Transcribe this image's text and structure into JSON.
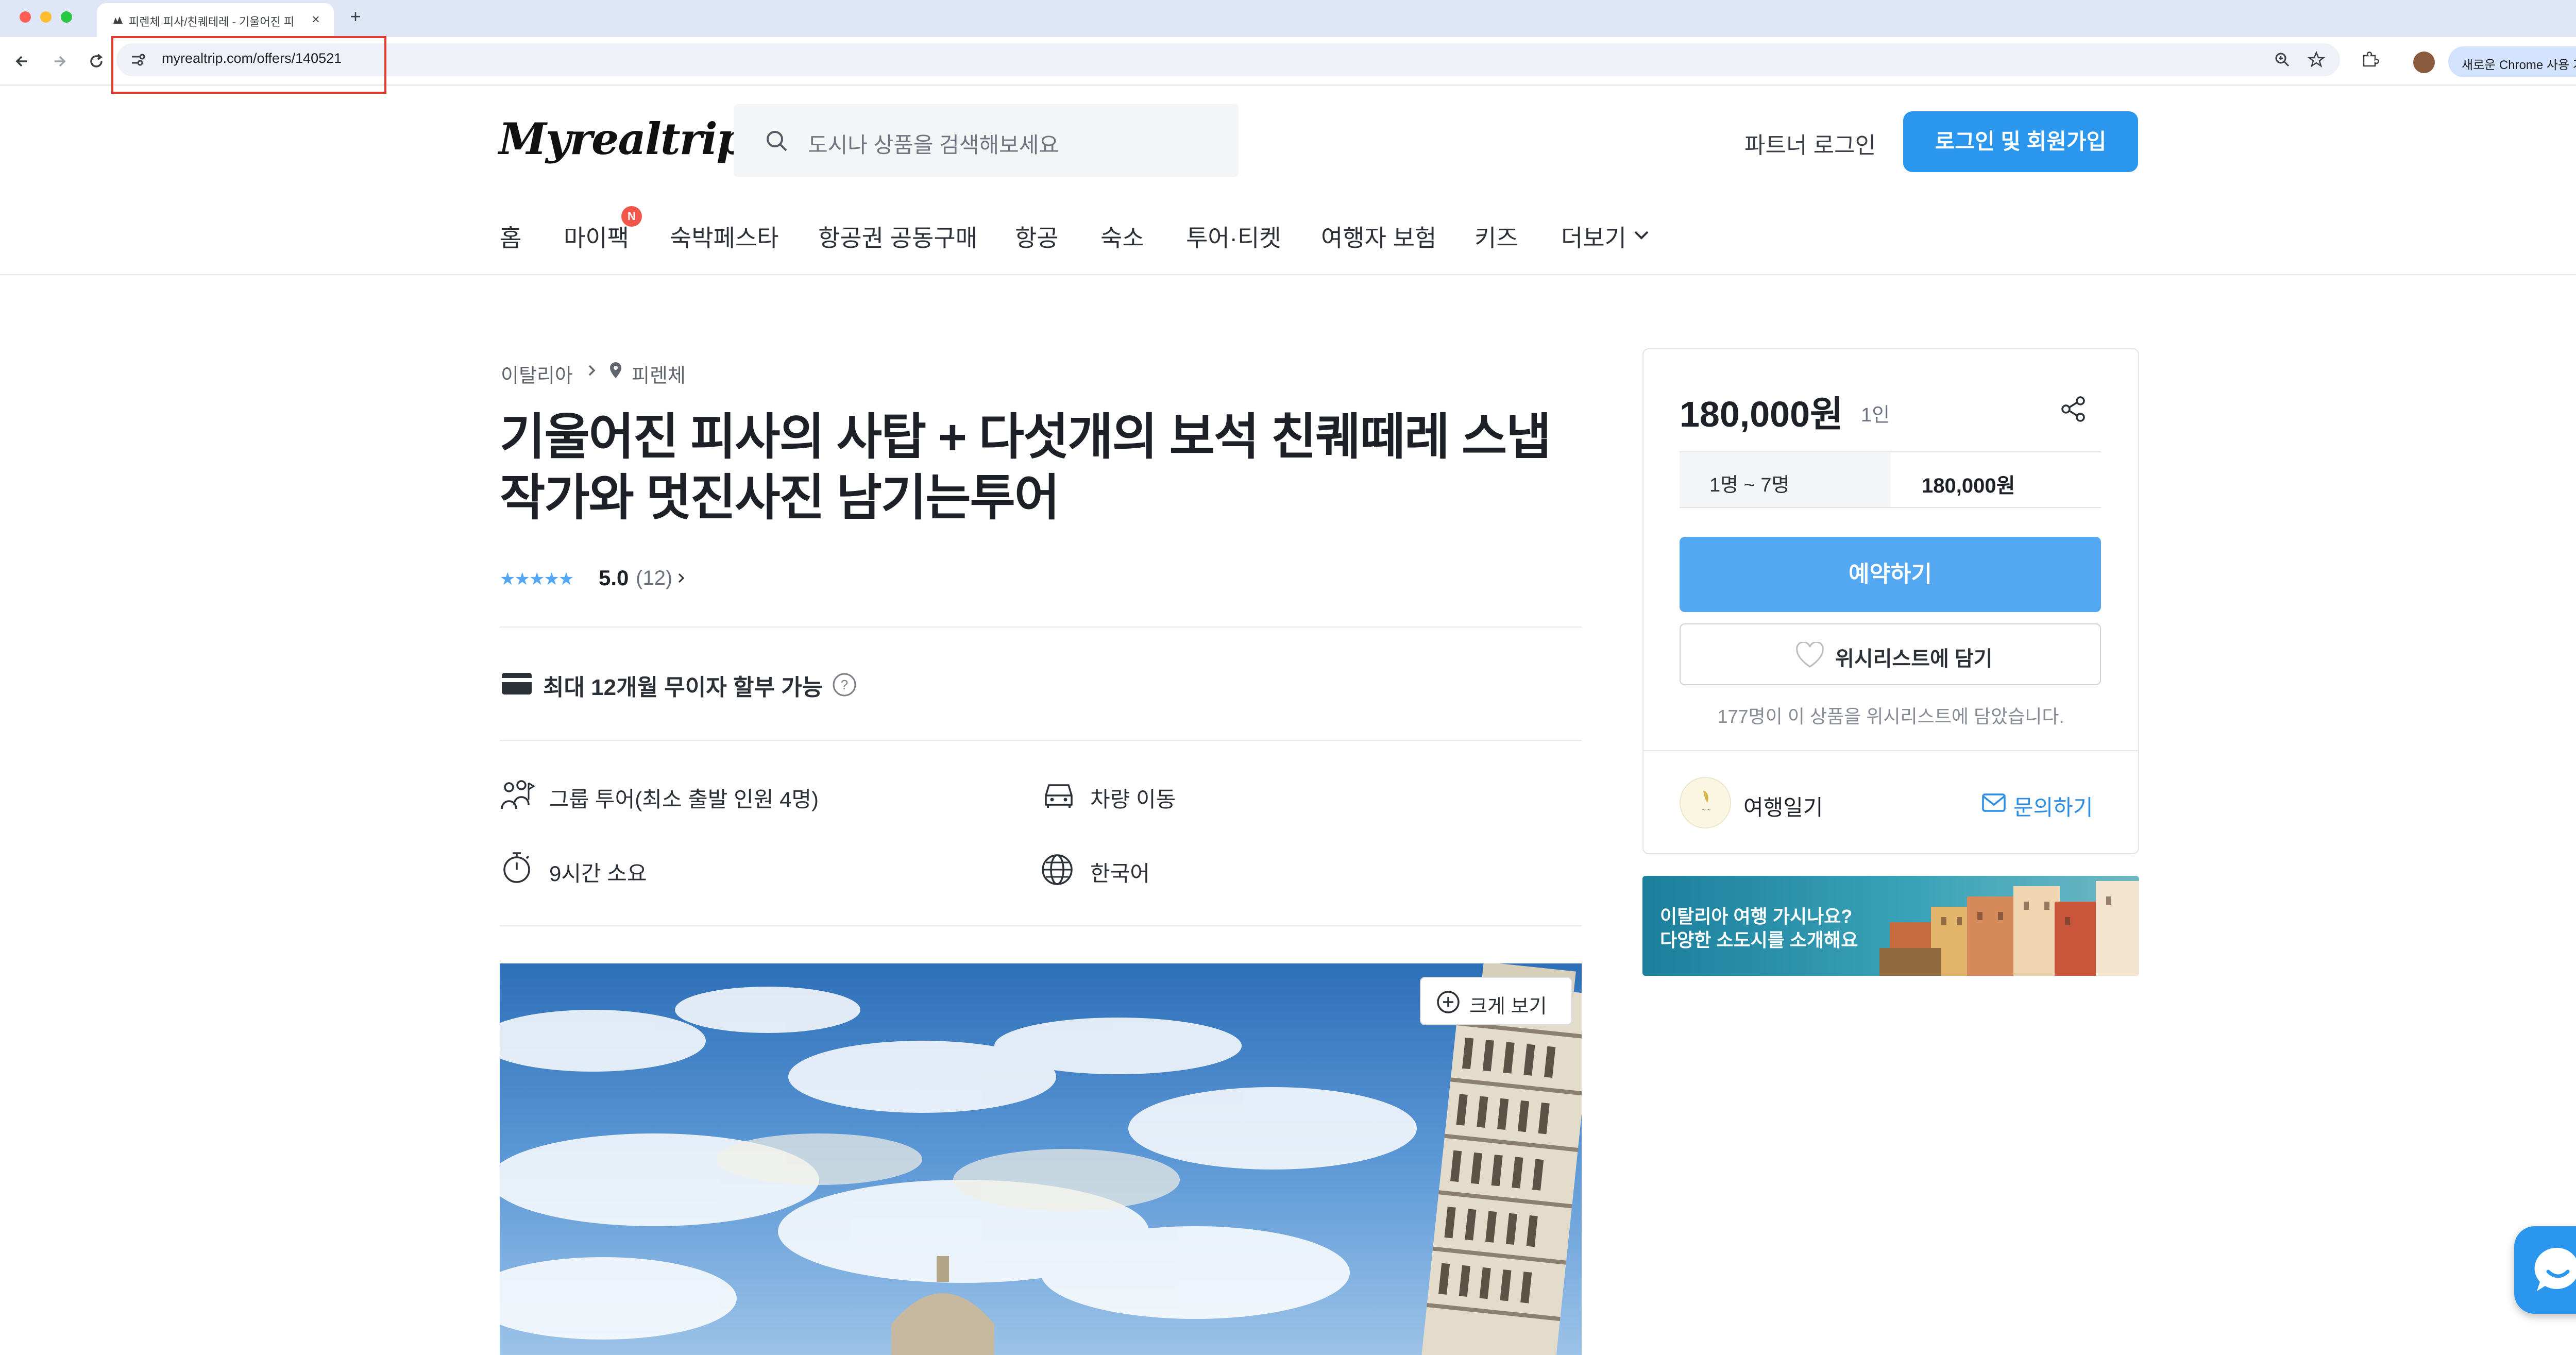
{
  "browser": {
    "tab_title": "피렌체 피사/친퀘테레 - 기울어진 피",
    "url": "myrealtrip.com/offers/140521",
    "profile_pill": "새로운 Chrome 사용 가능"
  },
  "site": {
    "logo": "Myrealtrip",
    "search_placeholder": "도시나 상품을 검색해보세요",
    "partner_login": "파트너 로그인",
    "login_signup": "로그인 및 회원가입",
    "nav": [
      {
        "label": "홈"
      },
      {
        "label": "마이팩",
        "badge": "N"
      },
      {
        "label": "숙박페스타"
      },
      {
        "label": "항공권 공동구매"
      },
      {
        "label": "항공"
      },
      {
        "label": "숙소"
      },
      {
        "label": "투어·티켓"
      },
      {
        "label": "여행자 보험"
      },
      {
        "label": "키즈"
      },
      {
        "label": "더보기"
      }
    ]
  },
  "product": {
    "breadcrumb_country": "이탈리아",
    "breadcrumb_city": "피렌체",
    "title": "기울어진 피사의 사탑 + 다섯개의 보석 친퀘떼레 스냅작가와 멋진사진 남기는투어",
    "rating_score": "5.0",
    "rating_count": "(12)",
    "rating_stars": 5,
    "installment": "최대 12개월 무이자 할부 가능",
    "features": [
      {
        "icon": "group-tour-icon",
        "label": "그룹 투어(최소 출발 인원 4명)"
      },
      {
        "icon": "car-icon",
        "label": "차량 이동"
      },
      {
        "icon": "timer-icon",
        "label": "9시간 소요"
      },
      {
        "icon": "globe-icon",
        "label": "한국어"
      }
    ],
    "zoom_label": "크게 보기"
  },
  "booking": {
    "price": "180,000원",
    "per_person": "1인",
    "option_people": "1명 ~ 7명",
    "option_price": "180,000원",
    "book_label": "예약하기",
    "wishlist_label": "위시리스트에 담기",
    "wishlist_count_text": "177명이 이 상품을 위시리스트에 담았습니다.",
    "host_name": "여행일기",
    "contact_label": "문의하기"
  },
  "banner": {
    "line1": "이탈리아 여행 가시나요?",
    "line2": "다양한 소도시를 소개해요"
  },
  "colors": {
    "brand_blue": "#2b96ed",
    "book_blue": "#53a8f1",
    "highlight_red": "#e03c2f"
  }
}
